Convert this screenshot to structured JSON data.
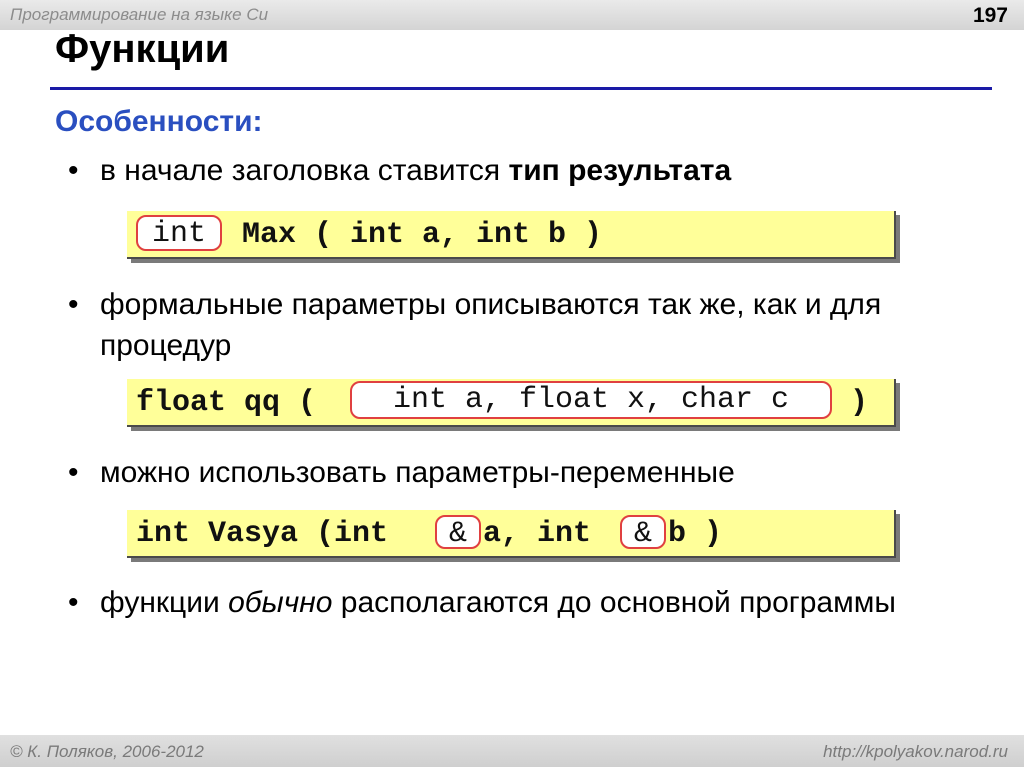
{
  "header": {
    "course": "Программирование на языке Си",
    "page_number": "197"
  },
  "slide": {
    "title": "Функции",
    "subheading": "Особенности:",
    "bullet_glyph": "•",
    "bullets": [
      {
        "text_before": "в начале заголовка ставится ",
        "text_bold": "тип результата"
      },
      {
        "text": "формальные параметры описываются так же, как и для процедур"
      },
      {
        "text": "можно использовать параметры-переменные"
      },
      {
        "text_before": "функции ",
        "text_italic": "обычно",
        "text_after": " располагаются до основной программы"
      }
    ],
    "code_examples": [
      {
        "highlight": "int",
        "rest": " Max ( int a, int b )"
      },
      {
        "before": "float qq ( ",
        "highlight": "int a, float x, char c",
        "after": " )"
      },
      {
        "part1": "int Vasya (int ",
        "amp1": "&",
        "part2": "a, int ",
        "amp2": "&",
        "part3": "b )"
      }
    ]
  },
  "footer": {
    "copyright": "© К. Поляков, 2006-2012",
    "url": "http://kpolyakov.narod.ru"
  },
  "colors": {
    "title_rule": "#1a1aa6",
    "subheading": "#2a4fc0",
    "code_background": "#ffff99",
    "highlight_border": "#e04040"
  }
}
